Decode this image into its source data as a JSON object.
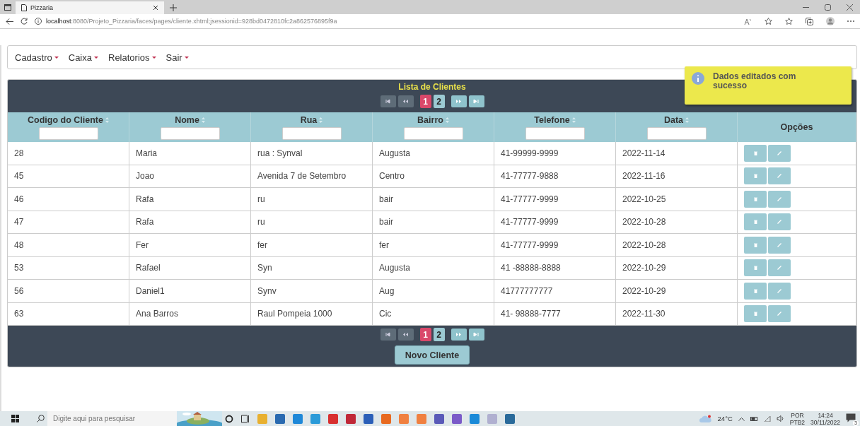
{
  "browser": {
    "tab_title": "Pizzaria",
    "url_host": "localhost",
    "url_path": ":8080/Projeto_Pizzaria/faces/pages/cliente.xhtml;jsessionid=928bd0472810fc2a862576895f9a"
  },
  "menu": [
    {
      "label": "Cadastro"
    },
    {
      "label": "Caixa"
    },
    {
      "label": "Relatorios"
    },
    {
      "label": "Sair"
    }
  ],
  "toast": {
    "message": "Dados editados com sucesso"
  },
  "table": {
    "title": "Lista de Clientes",
    "paginators": [
      {
        "first_disabled": true,
        "prev_disabled": true,
        "next_disabled": false,
        "last_disabled": false,
        "pages": [
          {
            "label": "1",
            "selected": true
          },
          {
            "label": "2",
            "selected": false
          }
        ]
      },
      {
        "first_disabled": true,
        "prev_disabled": true,
        "next_disabled": false,
        "last_disabled": false,
        "pages": [
          {
            "label": "1",
            "selected": true
          },
          {
            "label": "2",
            "selected": false
          }
        ]
      }
    ],
    "columns": [
      {
        "label": "Codigo do Cliente",
        "kind": "filter"
      },
      {
        "label": "Nome",
        "kind": "filter"
      },
      {
        "label": "Rua",
        "kind": "filter"
      },
      {
        "label": "Bairro",
        "kind": "filter"
      },
      {
        "label": "Telefone",
        "kind": "filter"
      },
      {
        "label": "Data",
        "kind": "filter"
      },
      {
        "label": "Opções",
        "kind": "actions"
      }
    ],
    "rows": [
      [
        "28",
        "Maria",
        "rua : Synval",
        "Augusta",
        "41-99999-9999",
        "2022-11-14"
      ],
      [
        "45",
        "Joao",
        "Avenida 7 de Setembro",
        "Centro",
        "41-77777-9888",
        "2022-11-16"
      ],
      [
        "46",
        "Rafa",
        "ru",
        "bair",
        "41-77777-9999",
        "2022-10-25"
      ],
      [
        "47",
        "Rafa",
        "ru",
        "bair",
        "41-77777-9999",
        "2022-10-28"
      ],
      [
        "48",
        "Fer",
        "fer",
        "fer",
        "41-77777-9999",
        "2022-10-28"
      ],
      [
        "53",
        "Rafael",
        "Syn",
        "Augusta",
        "41 -88888-8888",
        "2022-10-29"
      ],
      [
        "56",
        "Daniel1",
        "Synv",
        "Aug",
        "41777777777",
        "2022-10-29"
      ],
      [
        "63",
        "Ana Barros",
        "Raul Pompeia 1000",
        "Cic",
        "41- 98888-7777",
        "2022-11-30"
      ]
    ],
    "new_button": "Novo Cliente"
  },
  "taskbar": {
    "search_placeholder": "Digite aqui para pesquisar",
    "temperature": "24°C",
    "language": "POR",
    "layout": "PTB2",
    "time": "14:24",
    "date": "30/11/2022",
    "notifications": "3"
  }
}
